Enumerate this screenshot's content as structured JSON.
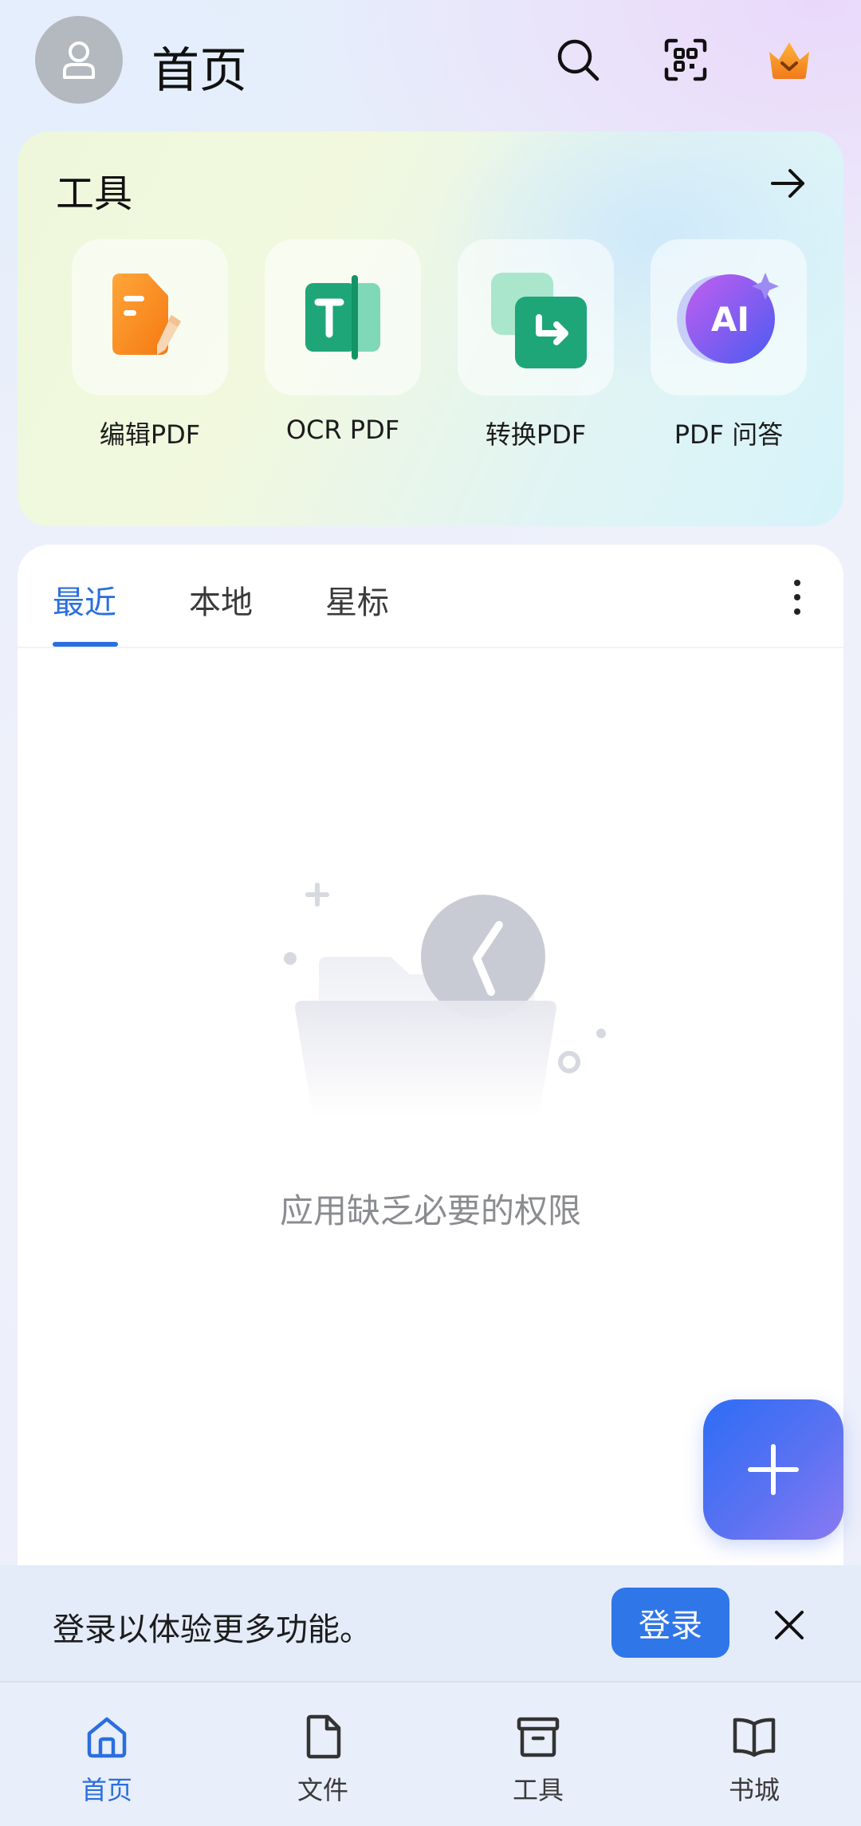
{
  "header": {
    "title": "首页",
    "icons": [
      "avatar-icon",
      "search-icon",
      "scan-icon",
      "vip-crown-icon"
    ]
  },
  "tools": {
    "title": "工具",
    "items": [
      {
        "label": "编辑PDF",
        "icon": "edit-pdf-icon"
      },
      {
        "label": "OCR PDF",
        "icon": "ocr-pdf-icon"
      },
      {
        "label": "转换PDF",
        "icon": "convert-pdf-icon"
      },
      {
        "label": "PDF 问答",
        "icon": "pdf-ai-qa-icon"
      }
    ]
  },
  "files": {
    "tabs": [
      {
        "label": "最近",
        "active": true
      },
      {
        "label": "本地",
        "active": false
      },
      {
        "label": "星标",
        "active": false
      }
    ],
    "empty_message": "应用缺乏必要的权限"
  },
  "login_banner": {
    "text": "登录以体验更多功能。",
    "button": "登录"
  },
  "bottom_nav": [
    {
      "label": "首页",
      "icon": "home-icon",
      "active": true
    },
    {
      "label": "文件",
      "icon": "file-icon",
      "active": false
    },
    {
      "label": "工具",
      "icon": "toolbox-icon",
      "active": false
    },
    {
      "label": "书城",
      "icon": "book-icon",
      "active": false
    }
  ],
  "colors": {
    "accent": "#2a6ee0",
    "fab_gradient_start": "#2d6df5",
    "fab_gradient_end": "#8a7af2",
    "login_button": "#2f76e8"
  }
}
